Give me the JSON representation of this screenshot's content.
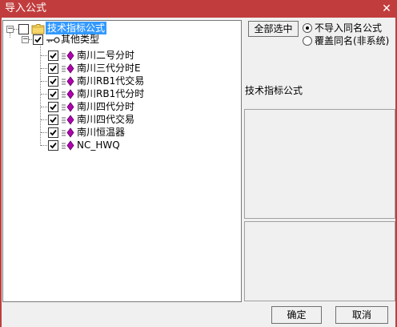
{
  "window": {
    "title": "导入公式",
    "close_glyph": "✕"
  },
  "tree": {
    "root": {
      "label": "技术指标公式",
      "expander": "−"
    },
    "group": {
      "label": "其他类型",
      "expander": "−"
    },
    "items": [
      {
        "label": "南川二号分时"
      },
      {
        "label": "南川三代分时E"
      },
      {
        "label": "南川RB1代交易"
      },
      {
        "label": "南川RB1代分时"
      },
      {
        "label": "南川四代分时"
      },
      {
        "label": "南川四代交易"
      },
      {
        "label": "南川恒温器"
      },
      {
        "label": "NC_HWQ"
      }
    ]
  },
  "options": {
    "select_all_label": "全部选中",
    "radio_no_import": "不导入同名公式",
    "radio_overwrite": "覆盖同名(非系统)",
    "selected_radio": "no_import"
  },
  "info": {
    "title": "技术指标公式"
  },
  "footer": {
    "ok_label": "确定",
    "cancel_label": "取消"
  },
  "colors": {
    "titlebar": "#c13d3d",
    "selection": "#3399ff",
    "formula_icon": "#b000b0"
  }
}
